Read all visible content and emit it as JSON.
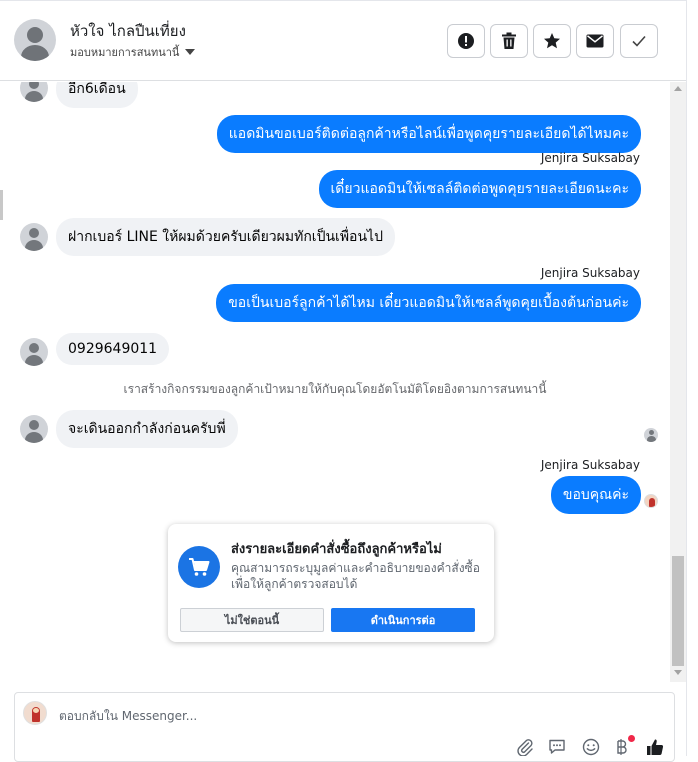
{
  "header": {
    "contact_name": "หัวใจ ไกลปืนเที่ยง",
    "assign_label": "มอบหมายการสนทนานี้",
    "buttons": [
      {
        "icon": "alert-icon",
        "label": "spam"
      },
      {
        "icon": "trash-icon",
        "label": "delete"
      },
      {
        "icon": "star-icon",
        "label": "star"
      },
      {
        "icon": "envelope-icon",
        "label": "mark-unread"
      },
      {
        "icon": "check-icon",
        "label": "done"
      }
    ]
  },
  "messages": {
    "m1_in": "อีก6เดือน",
    "m2_out": "แอดมินขอเบอร์ติดต่อลูกค้าหรือไลน์เพื่อพูดคุยรายละเอียดได้ไหมคะ",
    "sender_1": "Jenjira Suksabay",
    "m3_out": "เดี๋ยวแอดมินให้เซลล์ติดต่อพูดคุยรายละเอียดนะคะ",
    "m4_in": "ฝากเบอร์ LINE ให้ผมด้วยครับเดียวผมทักเป็นเพื่อนไป",
    "sender_2": "Jenjira Suksabay",
    "m5_out": "ขอเป็นเบอร์ลูกค้าได้ไหม เดี๋ยวแอดมินให้เซลล์พูดคุยเบื้องต้นก่อนค่ะ",
    "m6_in": "0929649011",
    "system_note": "เราสร้างกิจกรรมของลูกค้าเป้าหมายให้กับคุณโดยอัตโนมัติโดยอิงตามการสนทนานี้",
    "m7_in": "จะเดินออกกำลังก่อนครับพี่",
    "sender_3": "Jenjira Suksabay",
    "m8_out": "ขอบคุณค่ะ"
  },
  "prompt_card": {
    "title": "ส่งรายละเอียดคำสั่งซื้อถึงลูกค้าหรือไม่",
    "description": "คุณสามารถระบุมูลค่าและคำอธิบายของคำสั่งซื้อเพื่อให้ลูกค้าตรวจสอบได้",
    "decline_label": "ไม่ใช่ตอนนี้",
    "continue_label": "ดำเนินการต่อ",
    "icon": "shopping-cart-icon"
  },
  "composer": {
    "placeholder": "ตอบกลับใน Messenger...",
    "tools": [
      "paperclip-icon",
      "speech-bubble-icon",
      "emoji-icon",
      "baht-icon",
      "thumbs-up-icon"
    ]
  },
  "colors": {
    "outgoing_bubble": "#0a7cff",
    "incoming_bubble": "#f0f2f5",
    "card_button": "#1877f2",
    "badge": "#f02849"
  }
}
